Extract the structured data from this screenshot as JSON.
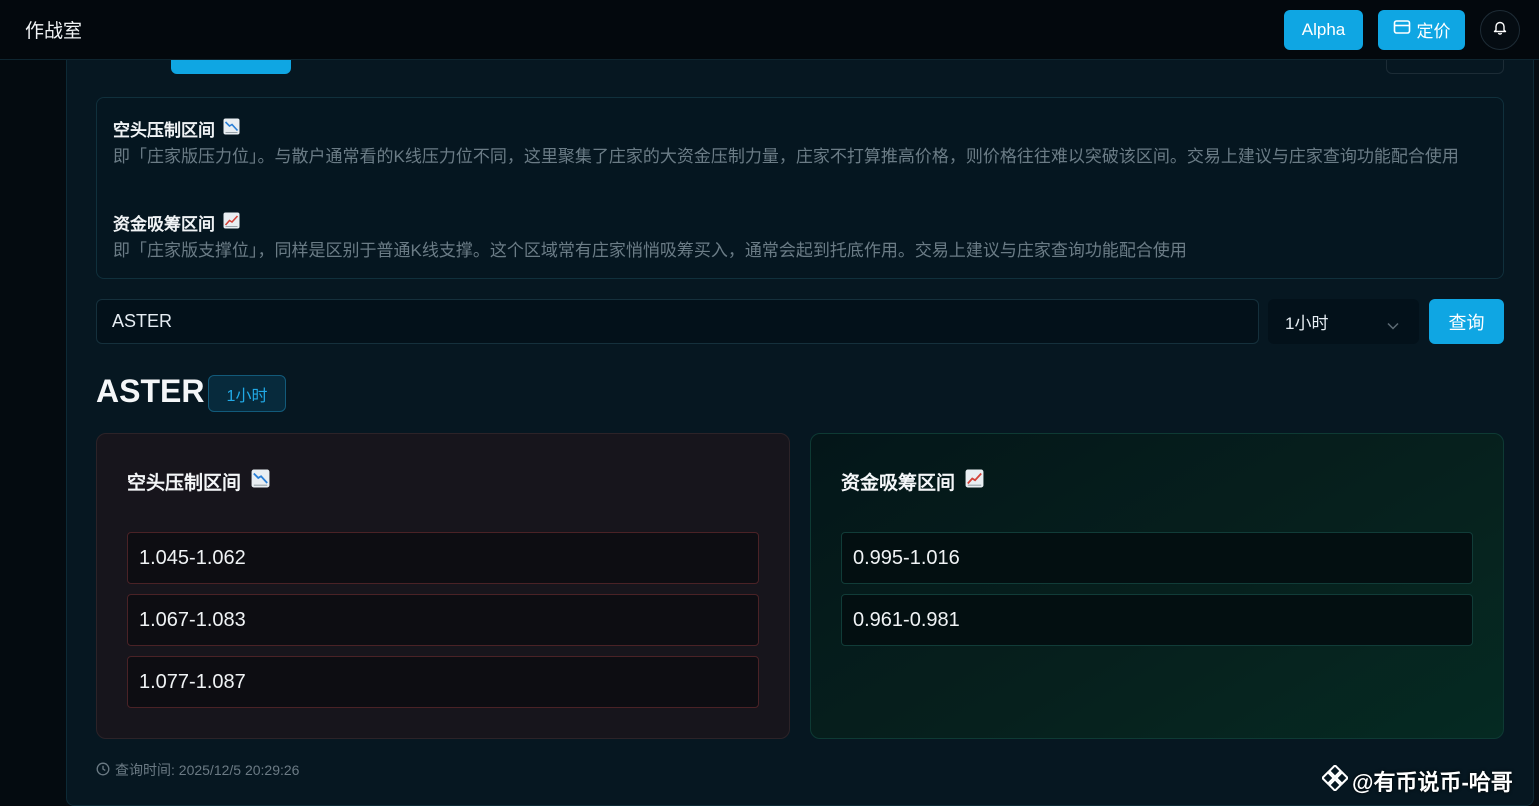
{
  "app": {
    "title": "作战室"
  },
  "header": {
    "alpha_label": "Alpha",
    "pricing_label": "定价"
  },
  "info": {
    "short_title": "空头压制区间",
    "short_desc": "即「庄家版压力位」。与散户通常看的K线压力位不同，这里聚集了庄家的大资金压制力量，庄家不打算推高价格，则价格往往难以突破该区间。交易上建议与庄家查询功能配合使用",
    "long_title": "资金吸筹区间",
    "long_desc": "即「庄家版支撑位」，同样是区别于普通K线支撑。这个区域常有庄家悄悄吸筹买入，通常会起到托底作用。交易上建议与庄家查询功能配合使用"
  },
  "query": {
    "symbol_value": "ASTER",
    "interval_value": "1小时",
    "button_label": "查询"
  },
  "result": {
    "symbol": "ASTER",
    "interval": "1小时",
    "short_card": {
      "title": "空头压制区间",
      "ranges": [
        "1.045-1.062",
        "1.067-1.083",
        "1.077-1.087"
      ]
    },
    "long_card": {
      "title": "资金吸筹区间",
      "ranges": [
        "0.995-1.016",
        "0.961-0.981"
      ]
    },
    "timestamp": "查询时间: 2025/12/5 20:29:26"
  },
  "watermark": "@有币说币-哈哥",
  "colors": {
    "accent": "#0fa6e3",
    "short_border": "#4a2226",
    "long_border": "#113c38"
  },
  "icons": {
    "short": "chart-decreasing-icon",
    "long": "chart-increasing-icon",
    "bell": "bell-icon",
    "pricing": "card-icon",
    "clock": "clock-icon",
    "chevron": "chevron-down-icon",
    "watermark_logo": "binance-logo-icon"
  }
}
